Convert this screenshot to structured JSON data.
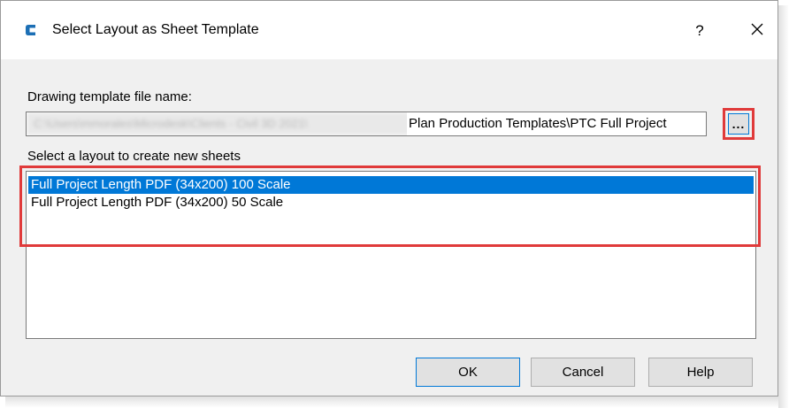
{
  "window": {
    "title": "Select Layout as Sheet Template",
    "app_icon": "civil3d-c-icon",
    "help_label": "?",
    "close_icon": "close-icon"
  },
  "template_file": {
    "label": "Drawing template file name:",
    "value_obscured": "C:\\Users\\mmorales\\Microdesk\\Clients - Civil 3D 2021\\",
    "value_visible": "Plan Production Templates\\PTC Full Project",
    "browse_label": "...",
    "browse_icon": "ellipsis-icon"
  },
  "layout_list": {
    "label": "Select a layout to create new sheets",
    "items": [
      {
        "label": "Full Project Length PDF (34x200) 100 Scale",
        "selected": true
      },
      {
        "label": "Full Project Length PDF (34x200) 50 Scale",
        "selected": false
      }
    ]
  },
  "buttons": {
    "ok": "OK",
    "cancel": "Cancel",
    "help": "Help"
  },
  "colors": {
    "selection": "#0078d7",
    "highlight_annotation": "#e03a3a",
    "dialog_bg": "#f0f0f0"
  }
}
